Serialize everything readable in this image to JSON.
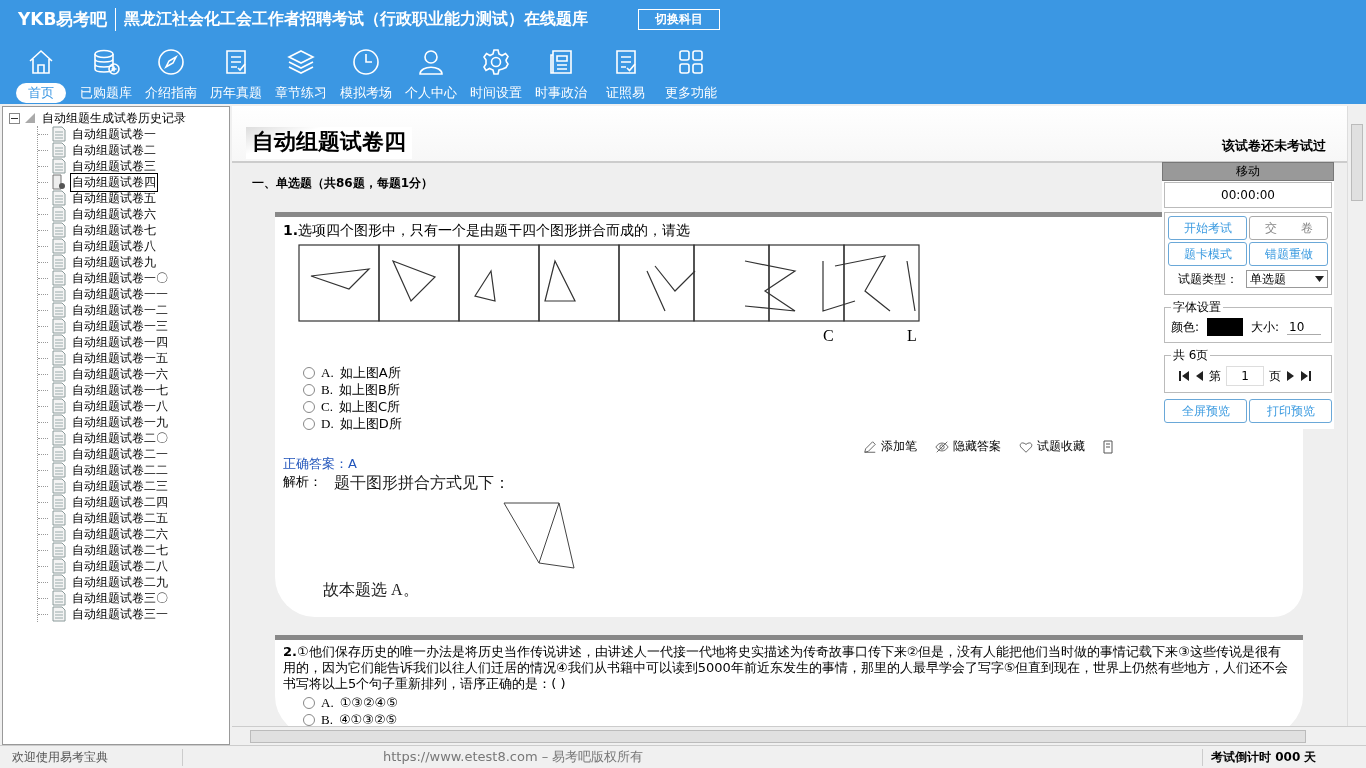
{
  "header": {
    "logo": "YKB易考吧",
    "title": "黑龙江社会化工会工作者招聘考试（行政职业能力测试）在线题库",
    "switch_button": "切换科目"
  },
  "nav": [
    {
      "label": "首页",
      "selected": true
    },
    {
      "label": "已购题库",
      "selected": false
    },
    {
      "label": "介绍指南",
      "selected": false
    },
    {
      "label": "历年真题",
      "selected": false
    },
    {
      "label": "章节练习",
      "selected": false
    },
    {
      "label": "模拟考场",
      "selected": false
    },
    {
      "label": "个人中心",
      "selected": false
    },
    {
      "label": "时间设置",
      "selected": false
    },
    {
      "label": "时事政治",
      "selected": false
    },
    {
      "label": "证照易",
      "selected": false
    },
    {
      "label": "更多功能",
      "selected": false
    }
  ],
  "tree": {
    "label": "自动组题生成试卷历史记录",
    "expanded": true,
    "children": [
      {
        "label": "自动组题试卷一",
        "selected": false
      },
      {
        "label": "自动组题试卷二",
        "selected": false
      },
      {
        "label": "自动组题试卷三",
        "selected": false
      },
      {
        "label": "自动组题试卷四",
        "selected": true
      },
      {
        "label": "自动组题试卷五",
        "selected": false
      },
      {
        "label": "自动组题试卷六",
        "selected": false
      },
      {
        "label": "自动组题试卷七",
        "selected": false
      },
      {
        "label": "自动组题试卷八",
        "selected": false
      },
      {
        "label": "自动组题试卷九",
        "selected": false
      },
      {
        "label": "自动组题试卷一〇",
        "selected": false
      },
      {
        "label": "自动组题试卷一一",
        "selected": false
      },
      {
        "label": "自动组题试卷一二",
        "selected": false
      },
      {
        "label": "自动组题试卷一三",
        "selected": false
      },
      {
        "label": "自动组题试卷一四",
        "selected": false
      },
      {
        "label": "自动组题试卷一五",
        "selected": false
      },
      {
        "label": "自动组题试卷一六",
        "selected": false
      },
      {
        "label": "自动组题试卷一七",
        "selected": false
      },
      {
        "label": "自动组题试卷一八",
        "selected": false
      },
      {
        "label": "自动组题试卷一九",
        "selected": false
      },
      {
        "label": "自动组题试卷二〇",
        "selected": false
      },
      {
        "label": "自动组题试卷二一",
        "selected": false
      },
      {
        "label": "自动组题试卷二二",
        "selected": false
      },
      {
        "label": "自动组题试卷二三",
        "selected": false
      },
      {
        "label": "自动组题试卷二四",
        "selected": false
      },
      {
        "label": "自动组题试卷二五",
        "selected": false
      },
      {
        "label": "自动组题试卷二六",
        "selected": false
      },
      {
        "label": "自动组题试卷二七",
        "selected": false
      },
      {
        "label": "自动组题试卷二八",
        "selected": false
      },
      {
        "label": "自动组题试卷二九",
        "selected": false
      },
      {
        "label": "自动组题试卷三〇",
        "selected": false
      },
      {
        "label": "自动组题试卷三一",
        "selected": false
      }
    ]
  },
  "paper": {
    "title": "自动组题试卷四",
    "status": "该试卷还未考试过",
    "section": "一、单选题（共86题，每题1分）",
    "questions": [
      {
        "number": "1.",
        "text": "选项四个图形中，只有一个是由题干四个图形拼合而成的，请选",
        "figure_labels": [
          "C",
          "L"
        ],
        "options": [
          {
            "letter": "A.",
            "text": "如上图A所",
            "checked": false
          },
          {
            "letter": "B.",
            "text": "如上图B所",
            "checked": false
          },
          {
            "letter": "C.",
            "text": "如上图C所",
            "checked": false
          },
          {
            "letter": "D.",
            "text": "如上图D所",
            "checked": false
          }
        ],
        "actions": [
          "添加笔",
          "隐藏答案",
          "试题收藏"
        ],
        "answer": "正确答案：A",
        "analysis_label": "解析：",
        "analysis": "题干图形拼合方式见下：",
        "conclusion": "故本题选 A。"
      },
      {
        "number": "2.",
        "text": "①他们保存历史的唯一办法是将历史当作传说讲述，由讲述人一代接一代地将史实描述为传奇故事口传下来②但是，没有人能把他们当时做的事情记载下来③这些传说是很有用的，因为它们能告诉我们以往人们迁居的情况④我们从书籍中可以读到5000年前近东发生的事情，那里的人最早学会了写字⑤但直到现在，世界上仍然有些地方，人们还不会书写将以上5个句子重新排列，语序正确的是：( )",
        "options": [
          {
            "letter": "A.",
            "text": "①③②④⑤",
            "checked": false
          },
          {
            "letter": "B.",
            "text": "④①③②⑤",
            "checked": false
          }
        ]
      }
    ]
  },
  "side_panel": {
    "title": "移动",
    "timer": "00:00:00",
    "buttons": [
      "开始考试",
      "交　　卷",
      "题卡模式",
      "错题重做"
    ],
    "type_label": "试题类型：",
    "type_value": "单选题",
    "font_group": "字体设置",
    "color_label": "颜色:",
    "size_label": "大小:",
    "size_value": "10",
    "pages_group": "共 6页",
    "page_prefix": "第",
    "page_value": "1",
    "page_suffix": "页",
    "preview_buttons": [
      "全屏预览",
      "打印预览"
    ]
  },
  "status_bar": {
    "welcome": "欢迎使用易考宝典",
    "copyright": "https://www.etest8.com – 易考吧版权所有",
    "countdown": "考试倒计时 000 天"
  }
}
